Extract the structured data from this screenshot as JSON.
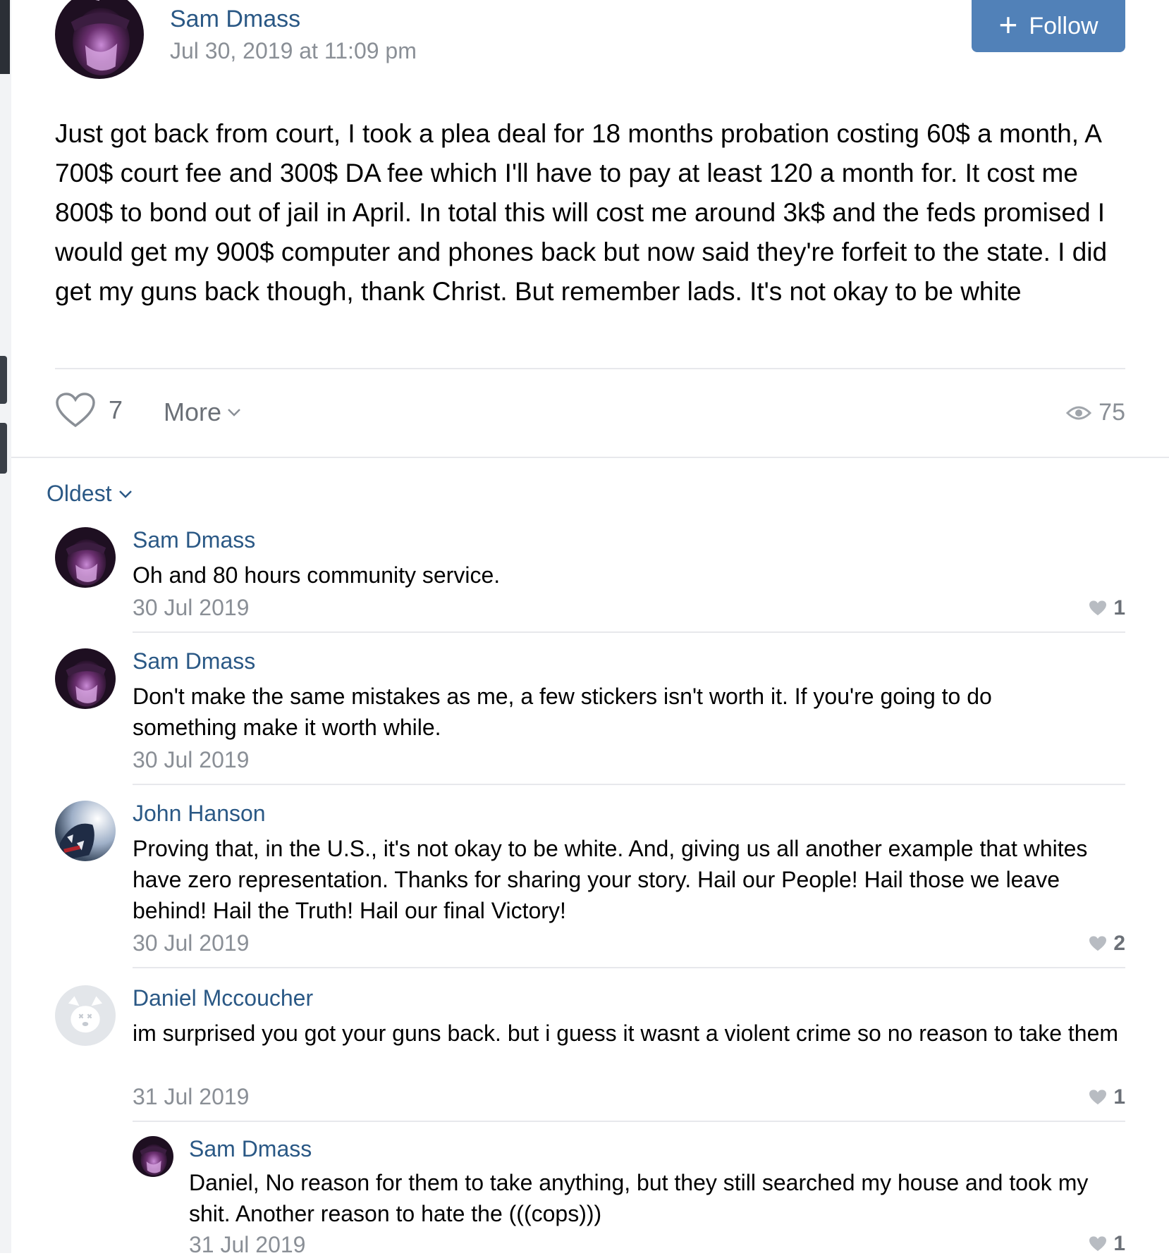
{
  "post": {
    "author": "Sam Dmass",
    "date": "Jul 30, 2019 at 11:09 pm",
    "follow_label": "Follow",
    "body": "Just got back from court, I took a plea deal for 18 months probation costing 60$ a month, A 700$ court fee and 300$ DA fee which I'll have to pay at least 120 a month for. It cost me 800$ to bond out of jail in April. In total this will cost me around 3k$ and the feds promised I would get my 900$ computer and phones back but now said they're forfeit to the state. I did get my guns back though, thank Christ. But remember lads. It's not okay to be white",
    "likes": "7",
    "more_label": "More",
    "views": "75"
  },
  "comments_sort": "Oldest",
  "comments": [
    {
      "author": "Sam Dmass",
      "text": "Oh and 80 hours community service.",
      "date": "30 Jul 2019",
      "likes": "1"
    },
    {
      "author": "Sam Dmass",
      "text": "Don't make the same mistakes as me, a few stickers isn't worth it. If you're going to do something make it worth while.",
      "date": "30 Jul 2019",
      "likes": ""
    },
    {
      "author": "John Hanson",
      "text": "Proving that, in the U.S., it's not okay to be white. And, giving us all another example that whites have zero representation. Thanks for sharing your story. Hail our People! Hail those we leave behind! Hail the Truth! Hail our final Victory!",
      "date": "30 Jul 2019",
      "likes": "2"
    },
    {
      "author": "Daniel Mccoucher",
      "text": "im surprised you got your guns back. but i guess it wasnt a violent crime so no reason to take them",
      "date": "31 Jul 2019",
      "likes": "1"
    }
  ],
  "reply": {
    "author": "Sam Dmass",
    "text": "Daniel, No reason for them to take anything, but they still searched my house and took my shit. Another reason to hate the (((cops)))",
    "date": "31 Jul 2019",
    "likes": "1"
  },
  "colors": {
    "link": "#2a5885",
    "follow_button": "#5181b8",
    "muted": "#8a8f96",
    "divider": "#e7e8ec"
  },
  "icons": {
    "like": "heart-icon",
    "views": "eye-icon",
    "follow": "plus-icon",
    "dropdown": "chevron-down-icon"
  }
}
